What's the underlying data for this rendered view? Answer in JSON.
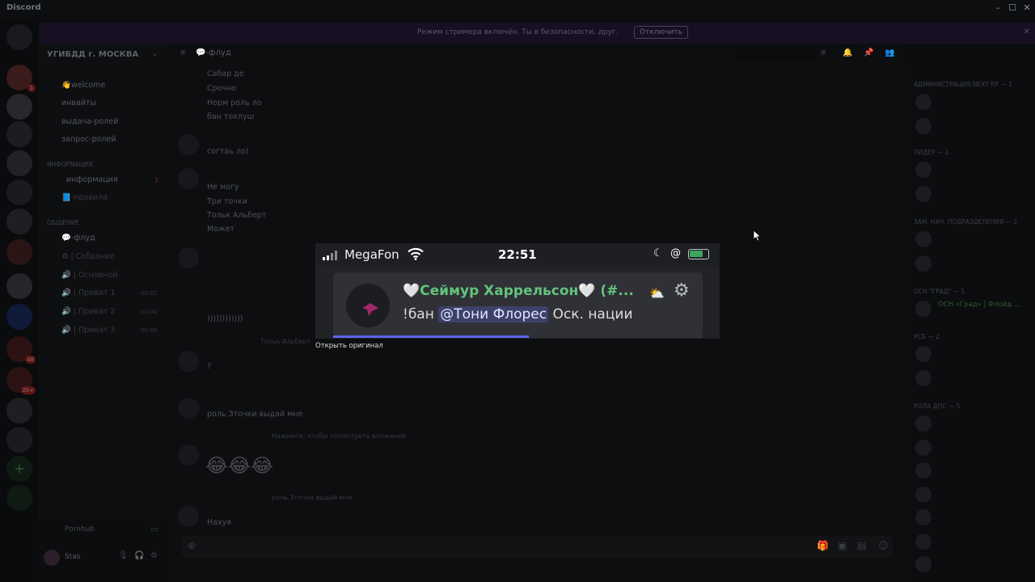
{
  "window": {
    "app_name": "Discord",
    "controls": [
      "–",
      "☐",
      "✕"
    ]
  },
  "banner": {
    "text": "Режим стримера включён. Ты в безопасности, друг.",
    "button": "Отключить",
    "close": "✕"
  },
  "server": {
    "name": "УГИБДД г. МОСКВА"
  },
  "channels": {
    "top": [
      "👋welcome",
      "инвайты",
      "выдача-ролей",
      "запрос-ролей"
    ],
    "cat_info": "ИНФОРМАЦИЯ",
    "info": [
      "информация",
      "📘-правила"
    ],
    "info_badge": "1",
    "cat_talk": "ОБЩЕНИЕ",
    "talk": [
      "💬-флуд",
      "♻ | Собрание",
      "🔊 | Основной",
      "🔊 | Приват 1",
      "🔊 | Приват 2",
      "🔊 | Приват 3"
    ],
    "voice_times": [
      "00:02",
      "00:04",
      "00:09"
    ]
  },
  "stream": {
    "title": "Pornhub"
  },
  "user": {
    "name": "Stas"
  },
  "chat": {
    "channel_title": "💬-флуд",
    "messages": [
      "Сабар де",
      "Срочно",
      "Норм роль ло",
      "бан тохлуш",
      "согтаь ло)",
      "Не могу",
      "Три точки",
      "Тольк Альберт",
      "Может",
      "))))))))))))",
      "Тольк Альберт",
      "?",
      "роль Зточки выдай мне",
      "Нажмите, чтобы посмотреть вложение",
      "роль Зточки выдай мне",
      "Нахуя"
    ],
    "emoji_row": "😂😂😂"
  },
  "members": {
    "categories": [
      "АДМИНИСТРАЦИЯ NEXT RP — 1",
      "ЛИДЕР — 2",
      "ЗАМ. НАЧ. ПОДРАЗДЕЛЕНИЯ — 2",
      "ОСН \"ГРАД\" — 1",
      "УСБ — 2",
      "РОЛА ДПС — 5"
    ],
    "names": [
      "ОСН «Град» | Флойд ..."
    ]
  },
  "overlay": {
    "carrier": "MegaFon",
    "time": "22:51",
    "title_name": "Сеймур Харрельсон",
    "title_suffix": "(#...",
    "body_prefix": "!бан",
    "body_mention": "@Тони Флорес",
    "body_suffix": "Оск. нации",
    "progress": 0.53,
    "battery_level": 0.75,
    "open_original": "Открыть оригинал"
  },
  "colors": {
    "accent": "#5865f2",
    "name_green": "#62c47c",
    "battery_green": "#3ba55d"
  }
}
